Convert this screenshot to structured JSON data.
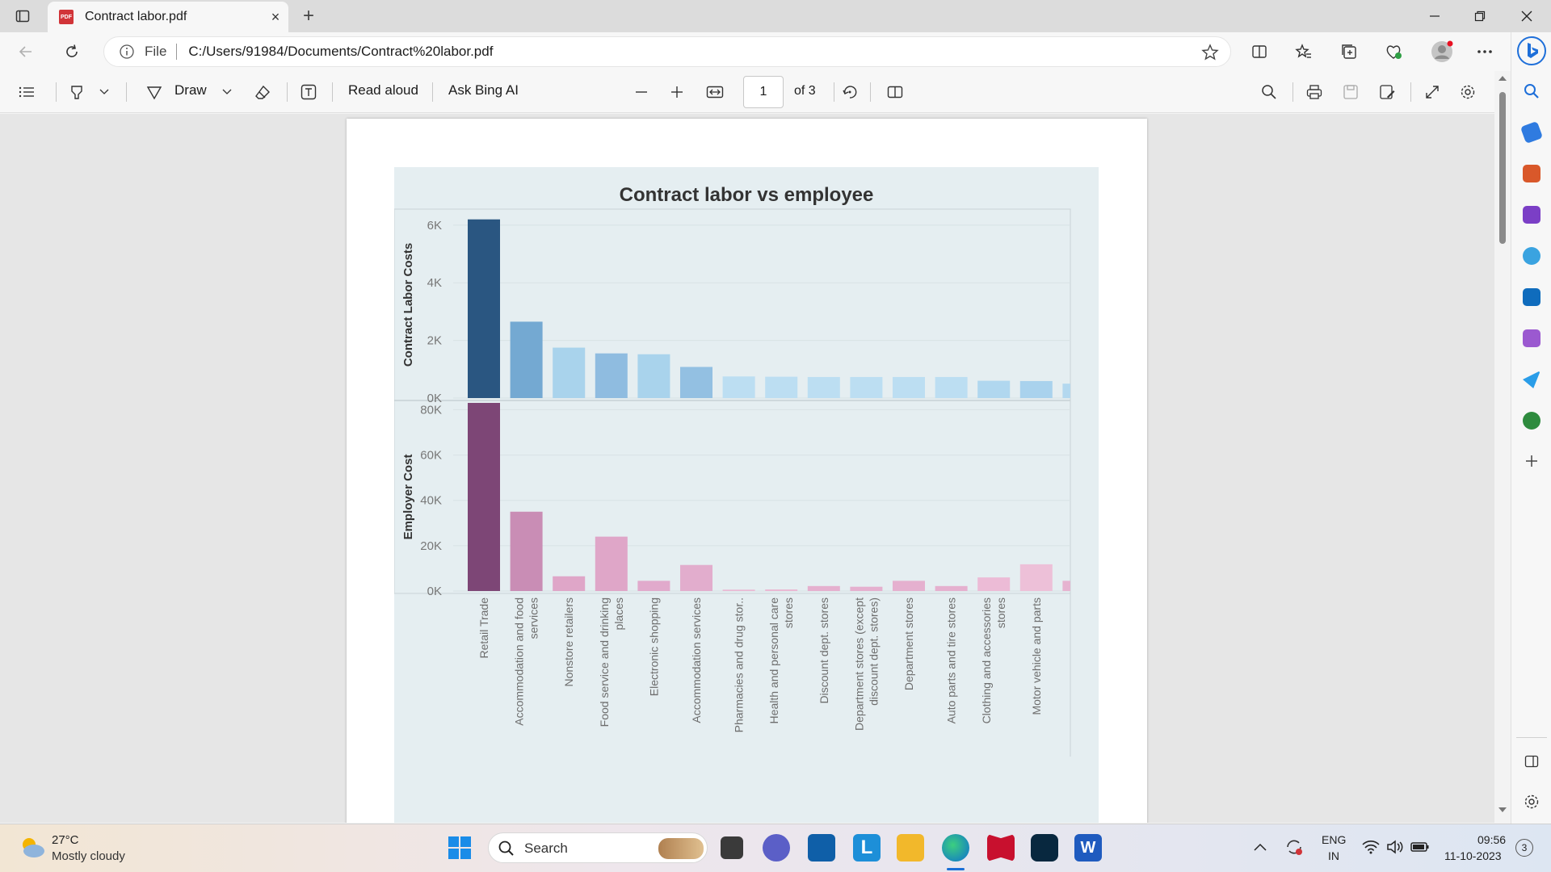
{
  "browser": {
    "tab_title": "Contract labor.pdf",
    "tab_close": "×",
    "new_tab": "+",
    "address_label": "File",
    "address_url": "C:/Users/91984/Documents/Contract%20labor.pdf"
  },
  "pdf_toolbar": {
    "draw_label": "Draw",
    "read_aloud_label": "Read aloud",
    "ask_bing_label": "Ask Bing AI",
    "page_number": "1",
    "page_total": "of 3"
  },
  "chart_data": {
    "type": "bar",
    "title": "Contract labor vs employee",
    "categories": [
      [
        "Retail Trade"
      ],
      [
        "Accommodation and food",
        "services"
      ],
      [
        "Nonstore retailers"
      ],
      [
        "Food service and drinking",
        "places"
      ],
      [
        "Electronic shopping"
      ],
      [
        "Accommodation services"
      ],
      [
        "Pharmacies and drug stor.."
      ],
      [
        "Health and personal care",
        "stores"
      ],
      [
        "Discount dept. stores"
      ],
      [
        "Department stores (except",
        "discount dept. stores)"
      ],
      [
        "Department stores"
      ],
      [
        "Auto parts and tire stores"
      ],
      [
        "Clothing and accessories",
        "stores"
      ],
      [
        "Motor vehicle and parts"
      ]
    ],
    "panels": [
      {
        "ylabel": "Contract Labor Costs",
        "yticks": [
          "6K",
          "4K",
          "2K",
          "0K"
        ],
        "ylim": [
          0,
          6500
        ],
        "values": [
          6200,
          2650,
          1750,
          1550,
          1520,
          1080,
          750,
          740,
          730,
          730,
          730,
          730,
          600,
          590,
          500
        ],
        "colors": [
          "#2a5681",
          "#74a9d2",
          "#a9d3ec",
          "#8fbce0",
          "#a9d3ec",
          "#93c0e2",
          "#bcdef2",
          "#bcdef2",
          "#bcdef2",
          "#bcdef2",
          "#bcdef2",
          "#bcdef2",
          "#b0d7ef",
          "#a9d2ed",
          "#b3d8ef"
        ]
      },
      {
        "ylabel": "Employer Cost",
        "yticks": [
          "80K",
          "60K",
          "40K",
          "20K",
          "0K"
        ],
        "ylim": [
          0,
          83000
        ],
        "values": [
          83000,
          35000,
          6500,
          24000,
          4500,
          11500,
          600,
          700,
          2200,
          1900,
          4500,
          2200,
          6000,
          11800,
          4500
        ],
        "colors": [
          "#7d4676",
          "#c98db5",
          "#dfa6c8",
          "#dfa6c8",
          "#e1aacc",
          "#e2adcd",
          "#eab8d3",
          "#eab8d3",
          "#e5b0cf",
          "#e5b0cf",
          "#e5b0cf",
          "#e5b0cf",
          "#ecbbd6",
          "#edc0d8",
          "#e6b3d0"
        ]
      }
    ]
  },
  "taskbar": {
    "weather_temp": "27°C",
    "weather_desc": "Mostly cloudy",
    "search_label": "Search",
    "lang_top": "ENG",
    "lang_bottom": "IN",
    "time": "09:56",
    "date": "11-10-2023",
    "notification_count": "3"
  }
}
